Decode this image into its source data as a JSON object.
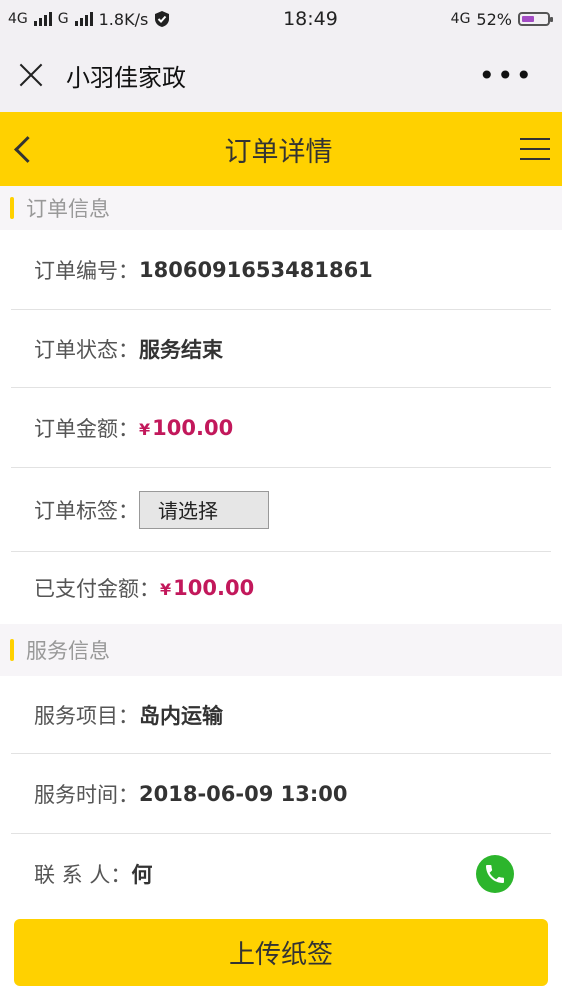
{
  "status_bar": {
    "left_text_1": "4G",
    "left_text_2": "G",
    "speed": "1.8K/s",
    "time": "18:49",
    "network": "4G",
    "battery": "52%"
  },
  "wx_header": {
    "title": "小羽佳家政",
    "more": "•••"
  },
  "nav": {
    "title": "订单详情"
  },
  "order_section": {
    "title": "订单信息",
    "rows": [
      {
        "label": "订单编号：",
        "value": "1806091653481861"
      },
      {
        "label": "订单状态：",
        "value": "服务结束"
      },
      {
        "label": "订单金额：",
        "currency": "¥",
        "value": "100.00"
      },
      {
        "label": "订单标签：",
        "value": "请选择"
      },
      {
        "label": "已支付金额：",
        "currency": "¥",
        "value": "100.00"
      }
    ]
  },
  "service_section": {
    "title": "服务信息",
    "rows": [
      {
        "label": "服务项目：",
        "value": "岛内运输"
      },
      {
        "label": "服务时间：",
        "value": "2018-06-09 13:00"
      },
      {
        "label": "联 系 人：",
        "value": "何"
      }
    ]
  },
  "bottom": {
    "upload_label": "上传纸签"
  },
  "colors": {
    "accent": "#ffd100",
    "money": "#c2185b",
    "phone": "#2cb52c"
  }
}
